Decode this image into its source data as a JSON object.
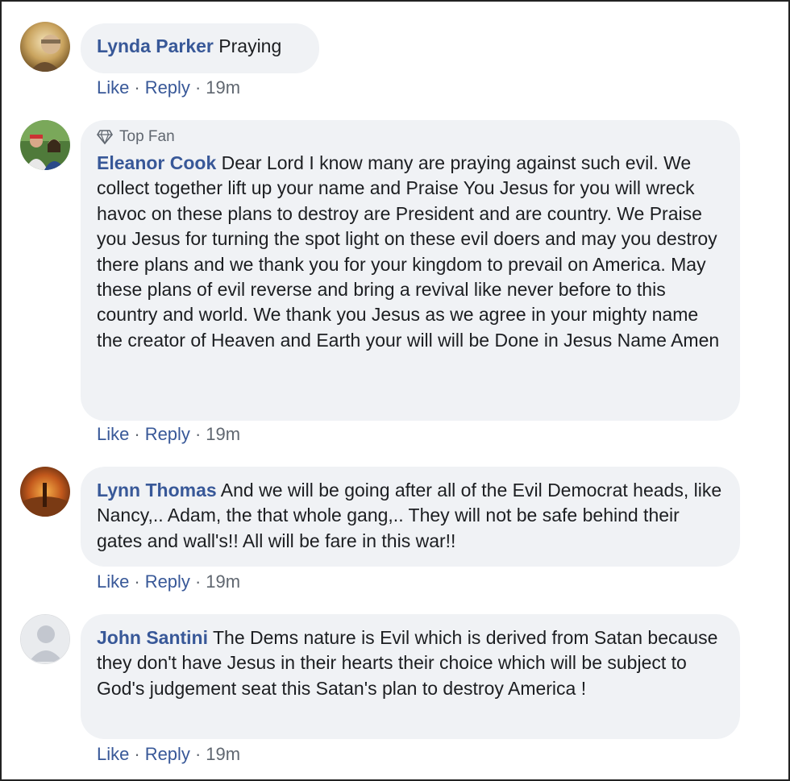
{
  "comments": [
    {
      "name": "Lynda Parker",
      "text": "Praying",
      "badge": "",
      "like": "Like",
      "reply": "Reply",
      "time": "19m",
      "avatar": "photo-avatar"
    },
    {
      "name": "Eleanor Cook",
      "text": "Dear Lord I know many are praying against such evil. We collect together lift up your name and Praise You Jesus for you will wreck havoc on these plans to destroy are President and are country. We Praise you Jesus for turning the spot light on these evil doers and may you destroy there plans and we thank you for your kingdom to prevail on America. May these plans of evil reverse and bring a revival like never before to this country and world. We thank you Jesus as we agree in your mighty name the creator of Heaven and Earth your will will be Done in Jesus Name Amen",
      "badge": "Top Fan",
      "like": "Like",
      "reply": "Reply",
      "time": "19m",
      "avatar": "photo-avatar"
    },
    {
      "name": "Lynn Thomas",
      "text": "And we will be going after all of the Evil Democrat heads, like Nancy,.. Adam, the that whole gang,.. They will not be safe behind their gates and wall's!! All will be fare in this war!!",
      "badge": "",
      "like": "Like",
      "reply": "Reply",
      "time": "19m",
      "avatar": "photo-avatar"
    },
    {
      "name": "John Santini",
      "text": "The Dems nature is Evil which is derived from Satan because they don't have Jesus in their hearts their choice which will be subject to God's judgement seat this Satan's plan to destroy America !",
      "badge": "",
      "like": "Like",
      "reply": "Reply",
      "time": "19m",
      "avatar": "default-avatar"
    }
  ],
  "colors": {
    "name": "#385898",
    "bubble": "#f0f2f5",
    "text": "#1c1e21",
    "meta": "#606770"
  },
  "icons": {
    "badge": "diamond-icon"
  }
}
